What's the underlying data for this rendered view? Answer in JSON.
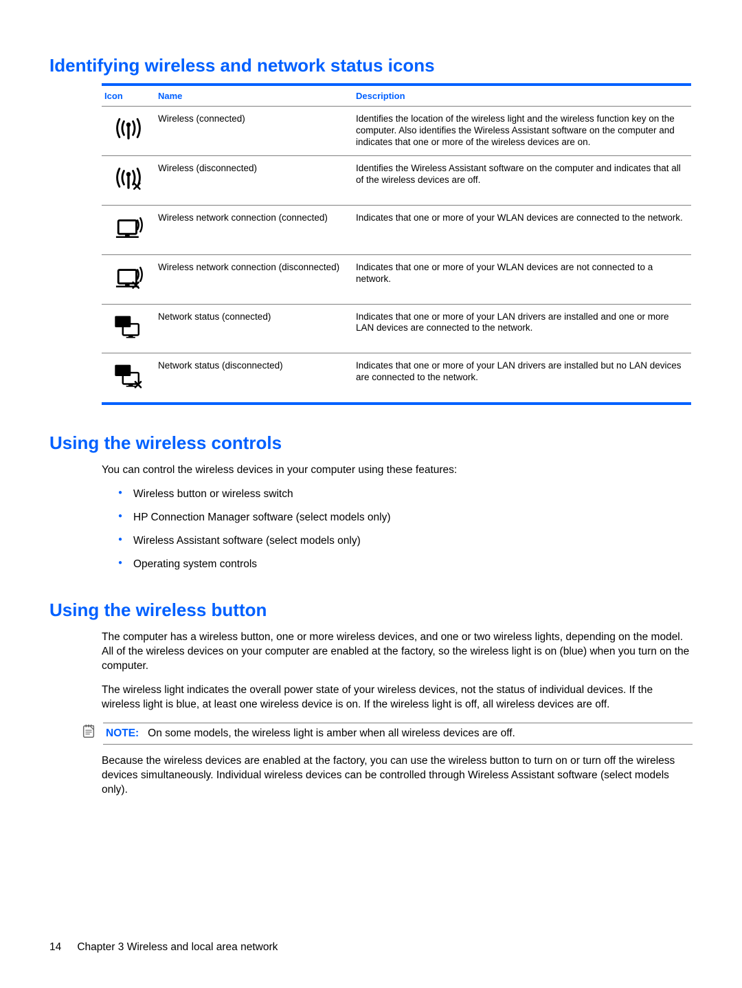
{
  "sections": {
    "table_heading": "Identifying wireless and network status icons",
    "controls_heading": "Using the wireless controls",
    "button_heading": "Using the wireless button"
  },
  "table": {
    "headers": {
      "icon": "Icon",
      "name": "Name",
      "description": "Description"
    },
    "rows": [
      {
        "name": "Wireless (connected)",
        "desc": "Identifies the location of the wireless light and the wireless function key on the computer. Also identifies the Wireless Assistant software on the computer and indicates that one or more of the wireless devices are on."
      },
      {
        "name": "Wireless (disconnected)",
        "desc": "Identifies the Wireless Assistant software on the computer and indicates that all of the wireless devices are off."
      },
      {
        "name": "Wireless network connection (connected)",
        "desc": "Indicates that one or more of your WLAN devices are connected to the network."
      },
      {
        "name": "Wireless network connection (disconnected)",
        "desc": "Indicates that one or more of your WLAN devices are not connected to a network."
      },
      {
        "name": "Network status (connected)",
        "desc": "Indicates that one or more of your LAN drivers are installed and one or more LAN devices are connected to the network."
      },
      {
        "name": "Network status (disconnected)",
        "desc": "Indicates that one or more of your LAN drivers are installed but no LAN devices are connected to the network."
      }
    ]
  },
  "controls": {
    "intro": "You can control the wireless devices in your computer using these features:",
    "items": [
      "Wireless button or wireless switch",
      "HP Connection Manager software (select models only)",
      "Wireless Assistant software (select models only)",
      "Operating system controls"
    ]
  },
  "button_section": {
    "p1": "The computer has a wireless button, one or more wireless devices, and one or two wireless lights, depending on the model. All of the wireless devices on your computer are enabled at the factory, so the wireless light is on (blue) when you turn on the computer.",
    "p2": "The wireless light indicates the overall power state of your wireless devices, not the status of individual devices. If the wireless light is blue, at least one wireless device is on. If the wireless light is off, all wireless devices are off.",
    "note_label": "NOTE:",
    "note_text": "On some models, the wireless light is amber when all wireless devices are off.",
    "p3": "Because the wireless devices are enabled at the factory, you can use the wireless button to turn on or turn off the wireless devices simultaneously. Individual wireless devices can be controlled through Wireless Assistant software (select models only)."
  },
  "footer": {
    "page": "14",
    "chapter": "Chapter 3   Wireless and local area network"
  }
}
